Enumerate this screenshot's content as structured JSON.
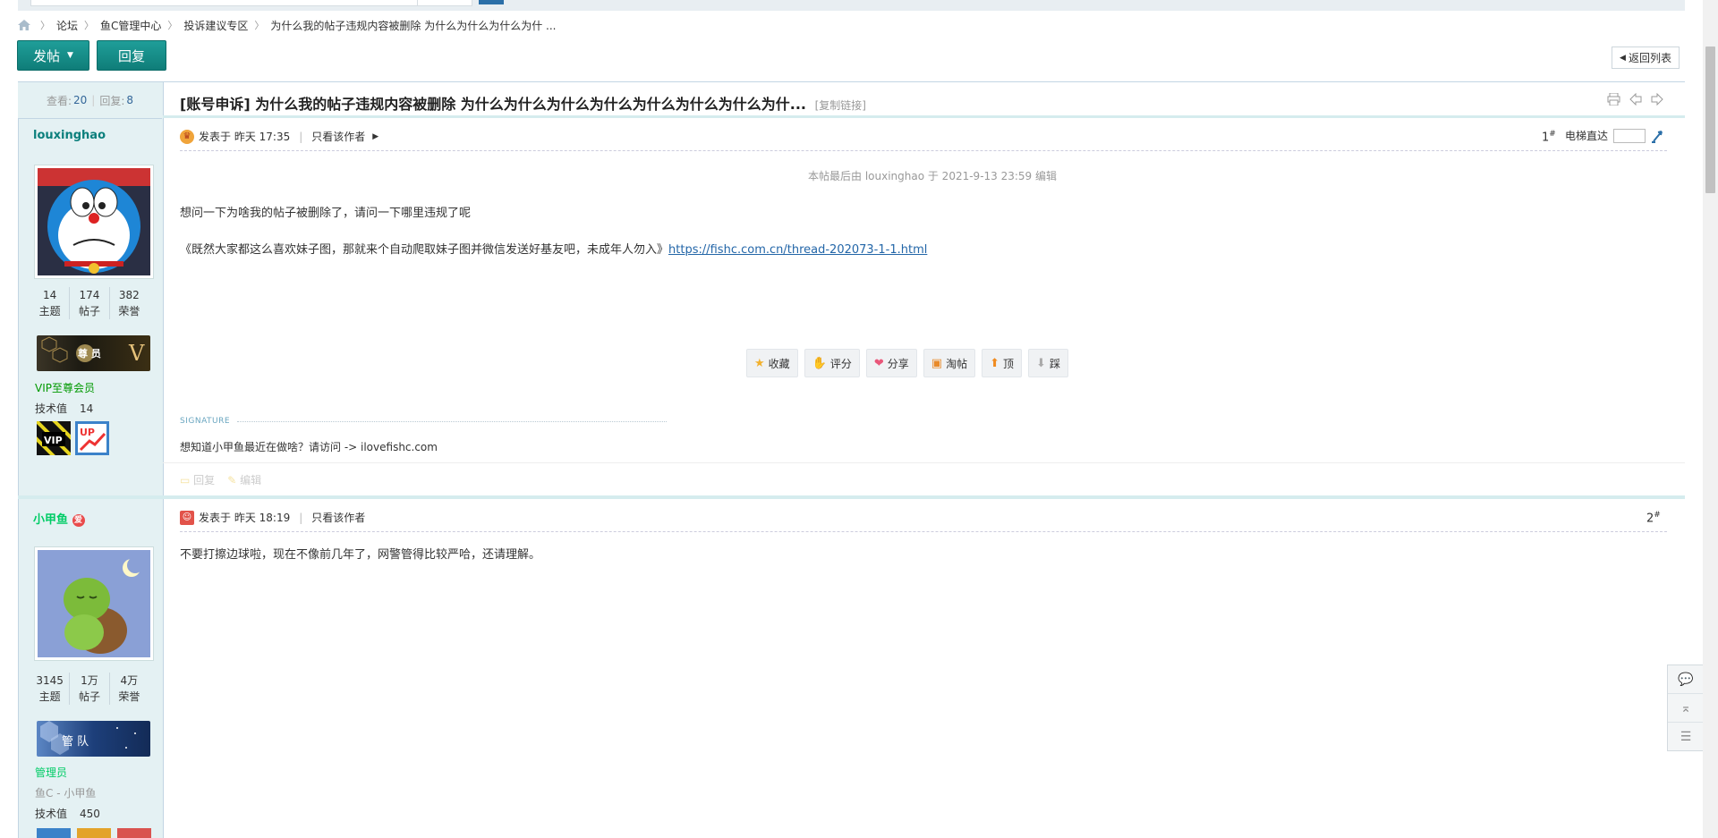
{
  "breadcrumb": {
    "items": [
      "论坛",
      "鱼C管理中心",
      "投诉建议专区",
      "为什么我的帖子违规内容被删除 为什么为什么为什么为什 ..."
    ]
  },
  "toolbar": {
    "post_label": "发帖",
    "reply_label": "回复",
    "back_label": "返回列表"
  },
  "thread": {
    "views_label": "查看:",
    "views": "20",
    "replies_label": "回复:",
    "replies": "8",
    "title": "[账号申诉] 为什么我的帖子违规内容被删除 为什么为什么为什么为什么为什么为什么为什么为什...",
    "copy_link": "[复制链接]"
  },
  "posts": [
    {
      "author": "louxinghao",
      "stats": [
        {
          "value": "14",
          "label": "主题"
        },
        {
          "value": "174",
          "label": "帖子"
        },
        {
          "value": "382",
          "label": "荣誉"
        }
      ],
      "banner_text": "尊   员",
      "group": "VIP至尊会员",
      "tech_label": "技术值",
      "tech_value": "14",
      "posted": "发表于 昨天 17:35",
      "author_only": "只看该作者",
      "floor": "1",
      "elevator": "电梯直达",
      "edit_note": "本帖最后由 louxinghao 于 2021-9-13 23:59 编辑",
      "content_1": "想问一下为啥我的帖子被删除了，请问一下哪里违规了呢",
      "content_2": "《既然大家都这么喜欢妹子图，那就来个自动爬取妹子图并微信发送好基友吧，未成年人勿入》",
      "content_link": "https://fishc.com.cn/thread-202073-1-1.html",
      "actions": [
        "收藏",
        "评分",
        "分享",
        "淘帖",
        "顶",
        "踩"
      ],
      "signature_label": "SIGNATURE",
      "signature": "想知道小甲鱼最近在做啥？请访问 -> ilovefishc.com",
      "reply_label": "回复",
      "edit_label": "编辑"
    },
    {
      "author": "小甲鱼",
      "stats": [
        {
          "value": "3145",
          "label": "主题"
        },
        {
          "value": "1万",
          "label": "帖子"
        },
        {
          "value": "4万",
          "label": "荣誉"
        }
      ],
      "banner_text": "管   队",
      "group": "管理员",
      "subtitle": "鱼C - 小甲鱼",
      "tech_label": "技术值",
      "tech_value": "450",
      "posted": "发表于 昨天 18:19",
      "author_only": "只看该作者",
      "floor": "2",
      "content_1": "不要打擦边球啦，现在不像前几年了，网警管得比较严哈，还请理解。"
    }
  ],
  "colors": {
    "accent": "#0f7d79",
    "sidebar_bg": "#e4f1f3",
    "link": "#2366a8",
    "group_vip": "#009900",
    "group_admin": "#00cc66"
  }
}
